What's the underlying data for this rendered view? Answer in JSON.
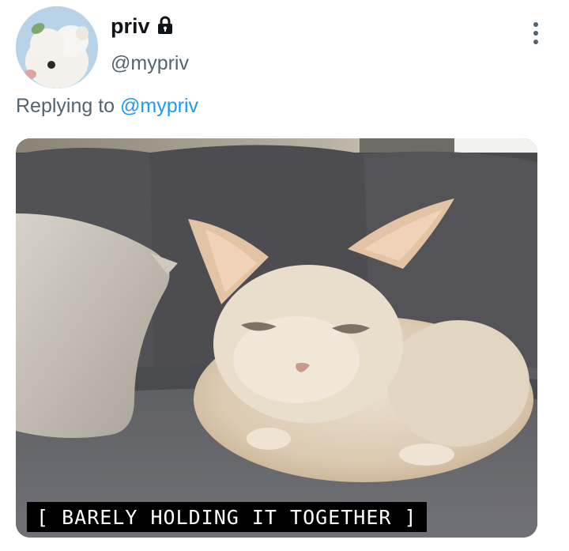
{
  "tweet": {
    "author": {
      "display_name": "priv",
      "handle": "@mypriv",
      "protected_icon": "lock-icon",
      "avatar_icon": "ferret-avatar"
    },
    "more_icon": "more-vertical-icon",
    "reply": {
      "prefix": "Replying to",
      "mention": "@mypriv"
    },
    "media": {
      "caption": "[ BARELY HOLDING IT TOGETHER ]"
    }
  },
  "colors": {
    "text_primary": "#0f1419",
    "text_secondary": "#536471",
    "link": "#1d9bf0",
    "background": "#ffffff"
  }
}
